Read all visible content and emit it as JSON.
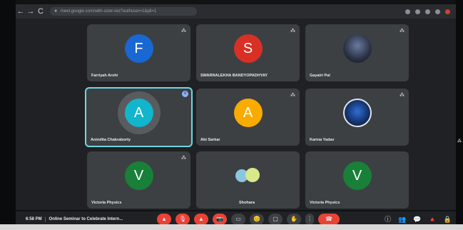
{
  "browser": {
    "url": "meet.google.com/wbh-ozwr-iwz?authuser=1&pli=1",
    "nav": [
      "←",
      "→",
      "C"
    ]
  },
  "participants": [
    {
      "name": "Farriyah Arshi",
      "initial": "F",
      "color": "#1967d2",
      "muted": true
    },
    {
      "name": "SWARNALEKHA BANDYOPADHYAY",
      "initial": "S",
      "color": "#d93025",
      "muted": true
    },
    {
      "name": "Gayatri Pal",
      "initial": "",
      "color": "",
      "photo": true,
      "muted": true
    },
    {
      "name": "Anindita Chakraborty",
      "initial": "A",
      "color": "#12b5cb",
      "muted": false,
      "active": true
    },
    {
      "name": "Abi Sarkar",
      "initial": "A",
      "color": "#f9ab00",
      "muted": true
    },
    {
      "name": "Karina Yadav",
      "initial": "",
      "color": "",
      "photo": true,
      "muted": true
    },
    {
      "name": "Victoria Physics",
      "initial": "V",
      "color": "#188038",
      "muted": true
    },
    {
      "name": "Shohara",
      "initial": "",
      "color": "",
      "photo": true,
      "muted": false
    },
    {
      "name": "Victoria Physics",
      "initial": "V",
      "color": "#188038",
      "muted": false
    }
  ],
  "bottom_bar": {
    "time": "6:58 PM",
    "separator": "|",
    "meeting_title": "Online Seminar to Celebrate Intern...",
    "controls": [
      "▲",
      "🎙",
      "▲",
      "📷",
      "▭",
      "😊",
      "▢",
      "✋",
      "⋮",
      "☎"
    ],
    "right": [
      "ⓘ",
      "👥",
      "💬",
      "🔺",
      "🔒"
    ]
  },
  "colors": {
    "active_border": "#6fd6e3",
    "end_call": "#ea4335"
  }
}
